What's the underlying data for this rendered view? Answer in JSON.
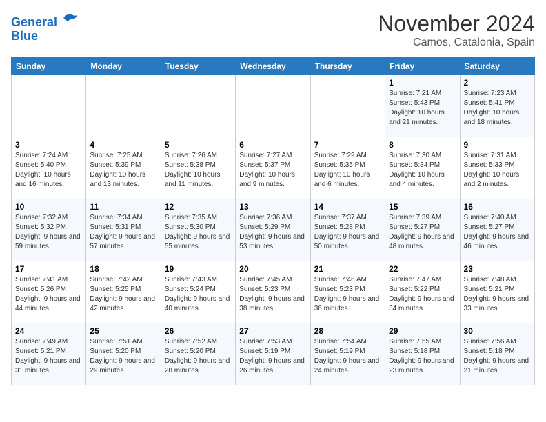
{
  "header": {
    "logo_line1": "General",
    "logo_line2": "Blue",
    "month": "November 2024",
    "location": "Camos, Catalonia, Spain"
  },
  "weekdays": [
    "Sunday",
    "Monday",
    "Tuesday",
    "Wednesday",
    "Thursday",
    "Friday",
    "Saturday"
  ],
  "weeks": [
    [
      {
        "day": "",
        "info": ""
      },
      {
        "day": "",
        "info": ""
      },
      {
        "day": "",
        "info": ""
      },
      {
        "day": "",
        "info": ""
      },
      {
        "day": "",
        "info": ""
      },
      {
        "day": "1",
        "info": "Sunrise: 7:21 AM\nSunset: 5:43 PM\nDaylight: 10 hours and 21 minutes."
      },
      {
        "day": "2",
        "info": "Sunrise: 7:23 AM\nSunset: 5:41 PM\nDaylight: 10 hours and 18 minutes."
      }
    ],
    [
      {
        "day": "3",
        "info": "Sunrise: 7:24 AM\nSunset: 5:40 PM\nDaylight: 10 hours and 16 minutes."
      },
      {
        "day": "4",
        "info": "Sunrise: 7:25 AM\nSunset: 5:39 PM\nDaylight: 10 hours and 13 minutes."
      },
      {
        "day": "5",
        "info": "Sunrise: 7:26 AM\nSunset: 5:38 PM\nDaylight: 10 hours and 11 minutes."
      },
      {
        "day": "6",
        "info": "Sunrise: 7:27 AM\nSunset: 5:37 PM\nDaylight: 10 hours and 9 minutes."
      },
      {
        "day": "7",
        "info": "Sunrise: 7:29 AM\nSunset: 5:35 PM\nDaylight: 10 hours and 6 minutes."
      },
      {
        "day": "8",
        "info": "Sunrise: 7:30 AM\nSunset: 5:34 PM\nDaylight: 10 hours and 4 minutes."
      },
      {
        "day": "9",
        "info": "Sunrise: 7:31 AM\nSunset: 5:33 PM\nDaylight: 10 hours and 2 minutes."
      }
    ],
    [
      {
        "day": "10",
        "info": "Sunrise: 7:32 AM\nSunset: 5:32 PM\nDaylight: 9 hours and 59 minutes."
      },
      {
        "day": "11",
        "info": "Sunrise: 7:34 AM\nSunset: 5:31 PM\nDaylight: 9 hours and 57 minutes."
      },
      {
        "day": "12",
        "info": "Sunrise: 7:35 AM\nSunset: 5:30 PM\nDaylight: 9 hours and 55 minutes."
      },
      {
        "day": "13",
        "info": "Sunrise: 7:36 AM\nSunset: 5:29 PM\nDaylight: 9 hours and 53 minutes."
      },
      {
        "day": "14",
        "info": "Sunrise: 7:37 AM\nSunset: 5:28 PM\nDaylight: 9 hours and 50 minutes."
      },
      {
        "day": "15",
        "info": "Sunrise: 7:39 AM\nSunset: 5:27 PM\nDaylight: 9 hours and 48 minutes."
      },
      {
        "day": "16",
        "info": "Sunrise: 7:40 AM\nSunset: 5:27 PM\nDaylight: 9 hours and 46 minutes."
      }
    ],
    [
      {
        "day": "17",
        "info": "Sunrise: 7:41 AM\nSunset: 5:26 PM\nDaylight: 9 hours and 44 minutes."
      },
      {
        "day": "18",
        "info": "Sunrise: 7:42 AM\nSunset: 5:25 PM\nDaylight: 9 hours and 42 minutes."
      },
      {
        "day": "19",
        "info": "Sunrise: 7:43 AM\nSunset: 5:24 PM\nDaylight: 9 hours and 40 minutes."
      },
      {
        "day": "20",
        "info": "Sunrise: 7:45 AM\nSunset: 5:23 PM\nDaylight: 9 hours and 38 minutes."
      },
      {
        "day": "21",
        "info": "Sunrise: 7:46 AM\nSunset: 5:23 PM\nDaylight: 9 hours and 36 minutes."
      },
      {
        "day": "22",
        "info": "Sunrise: 7:47 AM\nSunset: 5:22 PM\nDaylight: 9 hours and 34 minutes."
      },
      {
        "day": "23",
        "info": "Sunrise: 7:48 AM\nSunset: 5:21 PM\nDaylight: 9 hours and 33 minutes."
      }
    ],
    [
      {
        "day": "24",
        "info": "Sunrise: 7:49 AM\nSunset: 5:21 PM\nDaylight: 9 hours and 31 minutes."
      },
      {
        "day": "25",
        "info": "Sunrise: 7:51 AM\nSunset: 5:20 PM\nDaylight: 9 hours and 29 minutes."
      },
      {
        "day": "26",
        "info": "Sunrise: 7:52 AM\nSunset: 5:20 PM\nDaylight: 9 hours and 28 minutes."
      },
      {
        "day": "27",
        "info": "Sunrise: 7:53 AM\nSunset: 5:19 PM\nDaylight: 9 hours and 26 minutes."
      },
      {
        "day": "28",
        "info": "Sunrise: 7:54 AM\nSunset: 5:19 PM\nDaylight: 9 hours and 24 minutes."
      },
      {
        "day": "29",
        "info": "Sunrise: 7:55 AM\nSunset: 5:18 PM\nDaylight: 9 hours and 23 minutes."
      },
      {
        "day": "30",
        "info": "Sunrise: 7:56 AM\nSunset: 5:18 PM\nDaylight: 9 hours and 21 minutes."
      }
    ]
  ]
}
